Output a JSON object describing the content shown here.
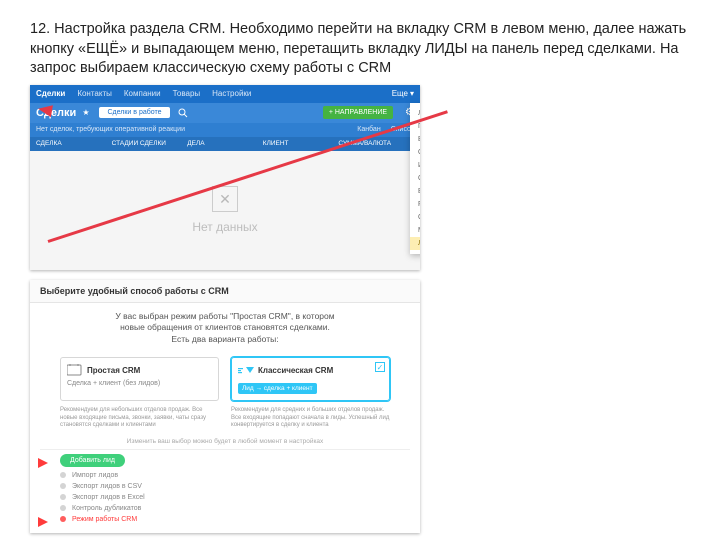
{
  "instruction": "12. Настройка раздела CRM. Необходимо перейти на вкладку CRM в левом меню, далее нажать кнопку «ЕЩЁ» и выпадающем меню, перетащить  вкладку ЛИДЫ на панель перед сделками. На запрос выбираем классическую схему работы с CRM",
  "shot1": {
    "topnav": [
      "Сделки",
      "Контакты",
      "Компании",
      "Товары",
      "Настройки"
    ],
    "more": "Еще",
    "title": "Сделки",
    "dropdown": "Сделки в работе",
    "addbtn": "+ НАПРАВЛЕНИЕ",
    "row3_left": "Нет сделок, требующих оперативной реакции",
    "row3_kanban": "Канбан",
    "row3_list": "Список",
    "cols": [
      "СДЕЛКА",
      "СТАДИИ СДЕЛКИ",
      "ДЕЛА",
      "КЛИЕНТ",
      "СУММА/ВАЛЮТА"
    ],
    "nodata": "Нет данных",
    "menu": [
      "Лента",
      "Предложения",
      "Воронка продаж",
      "Отчёты",
      "История",
      "CRM-формы",
      "Виджет на сайт",
      "Face-трекер",
      "Старт",
      "Мои дела"
    ],
    "menu_highlight": "Лиды"
  },
  "shot2": {
    "header": "Выберите удобный способ работы с CRM",
    "desc_line1": "У вас выбран режим работы \"Простая CRM\", в котором",
    "desc_line2": "новые обращения от клиентов становятся сделками.",
    "desc_line3": "Есть два варианта работы:",
    "card1_title": "Простая CRM",
    "card1_sub": "Сделка + клиент (без лидов)",
    "card2_title": "Классическая CRM",
    "card2_tag": "Лид → сделка + клиент",
    "rec1": "Рекомендуем для небольших отделов продаж. Все новые входящие письма, звонки, заявки, чаты сразу становятся сделками и клиентами",
    "rec2": "Рекомендуем для средних и больших отделов продаж. Все входящие попадают сначала в лиды. Успешный лид конвертируется в сделку и клиента",
    "footer_note": "Изменить ваш выбор можно будет в любой момент в настройках",
    "addlead": "Добавить лид",
    "links": [
      "Импорт лидов",
      "Экспорт лидов в CSV",
      "Экспорт лидов в Excel",
      "Контроль дубликатов"
    ],
    "link_red": "Режим работы CRM"
  }
}
